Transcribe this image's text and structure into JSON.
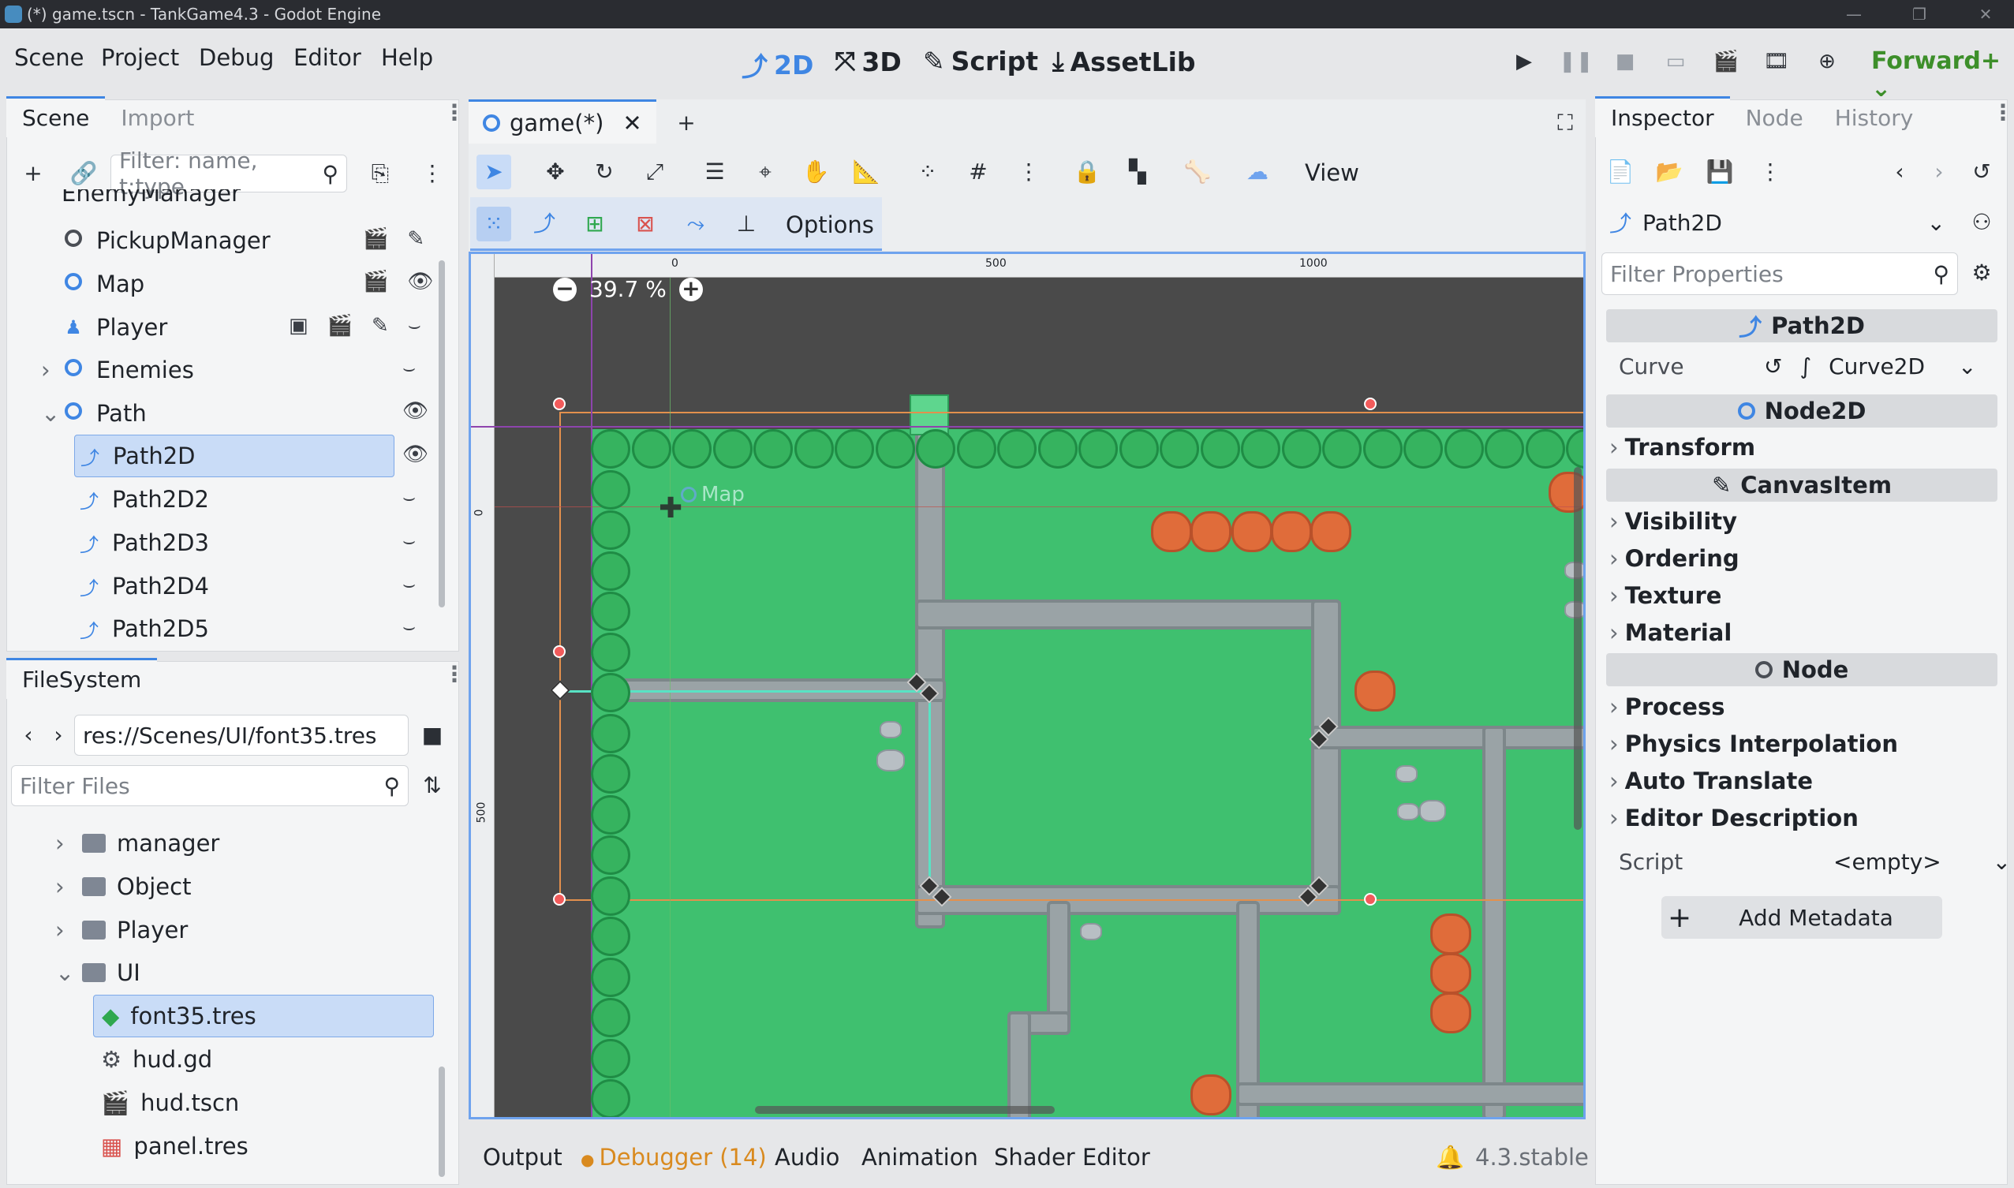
{
  "window": {
    "title": "(*) game.tscn - TankGame4.3 - Godot Engine",
    "min": "—",
    "max": "❐",
    "close": "✕"
  },
  "menu": [
    "Scene",
    "Project",
    "Debug",
    "Editor",
    "Help"
  ],
  "workspaces": [
    {
      "label": "2D",
      "icon": "⤴",
      "active": true
    },
    {
      "label": "3D",
      "icon": "⤧",
      "active": false
    },
    {
      "label": "Script",
      "icon": "✎",
      "active": false
    },
    {
      "label": "AssetLib",
      "icon": "⤓",
      "active": false
    }
  ],
  "renderer": "Forward+",
  "scene_dock": {
    "tabs": [
      "Scene",
      "Import"
    ],
    "filter_placeholder": "Filter: name, t:type",
    "nodes": [
      {
        "name": "EnemyManager",
        "icon": "ring"
      },
      {
        "name": "PickupManager",
        "icon": "ring-dark"
      },
      {
        "name": "Map",
        "icon": "ring"
      },
      {
        "name": "Player",
        "icon": "player"
      },
      {
        "name": "Enemies",
        "icon": "ring"
      },
      {
        "name": "Path",
        "icon": "ring"
      },
      {
        "name": "Path2D",
        "icon": "path"
      },
      {
        "name": "Path2D2",
        "icon": "path"
      },
      {
        "name": "Path2D3",
        "icon": "path"
      },
      {
        "name": "Path2D4",
        "icon": "path"
      },
      {
        "name": "Path2D5",
        "icon": "path"
      }
    ]
  },
  "filesystem": {
    "tab": "FileSystem",
    "path": "res://Scenes/UI/font35.tres",
    "filter_placeholder": "Filter Files",
    "items": [
      {
        "name": "manager",
        "type": "folder"
      },
      {
        "name": "Object",
        "type": "folder"
      },
      {
        "name": "Player",
        "type": "folder"
      },
      {
        "name": "UI",
        "type": "folder"
      },
      {
        "name": "font35.tres",
        "type": "font"
      },
      {
        "name": "hud.gd",
        "type": "script"
      },
      {
        "name": "hud.tscn",
        "type": "scene"
      },
      {
        "name": "panel.tres",
        "type": "resource"
      }
    ]
  },
  "editor": {
    "tab": "game(*)",
    "view_label": "View",
    "options_label": "Options",
    "zoom": "39.7 %",
    "ruler": {
      "r0": "0",
      "r500": "500",
      "r1000": "1000",
      "v0": "0",
      "v500": "500"
    },
    "map_label": "Map"
  },
  "bottom": {
    "tabs": [
      "Output",
      "Debugger (14)",
      "Audio",
      "Animation",
      "Shader Editor"
    ],
    "version": "4.3.stable"
  },
  "inspector": {
    "tabs": [
      "Inspector",
      "Node",
      "History"
    ],
    "node_type": "Path2D",
    "filter_placeholder": "Filter Properties",
    "section_path2d": "Path2D",
    "curve_label": "Curve",
    "curve_value": "Curve2D",
    "section_node2d": "Node2D",
    "transform": "Transform",
    "section_canvas": "CanvasItem",
    "canvas_props": [
      "Visibility",
      "Ordering",
      "Texture",
      "Material"
    ],
    "section_node": "Node",
    "node_props": [
      "Process",
      "Physics Interpolation",
      "Auto Translate",
      "Editor Description"
    ],
    "script_label": "Script",
    "script_value": "<empty>",
    "add_metadata": "Add Metadata"
  },
  "colors": {
    "accent": "#3f86e3",
    "grass": "#3fc06f",
    "renderer": "#3d8f2a",
    "debugger": "#d98a1f"
  }
}
